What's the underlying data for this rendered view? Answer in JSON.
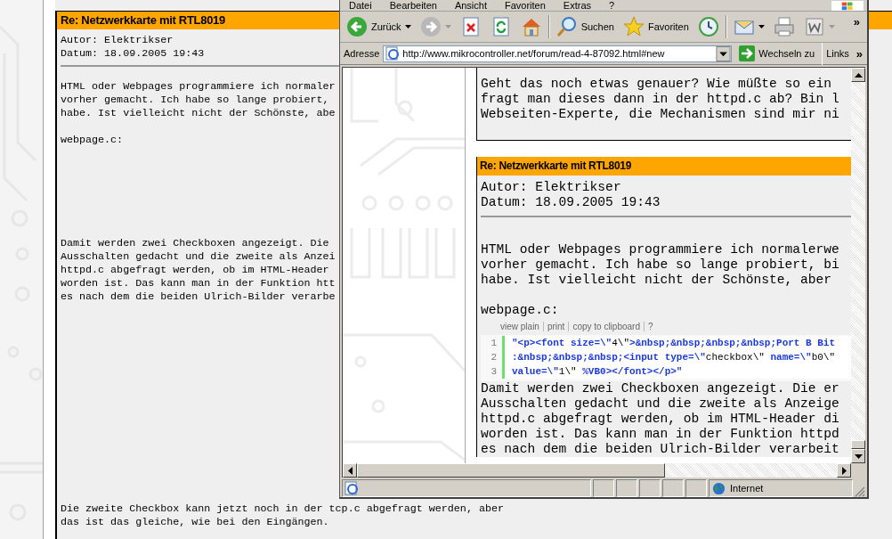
{
  "background_page": {
    "post": {
      "title": "Re: Netzwerkkarte mit RTL8019",
      "author": "Autor: Elektrikser",
      "date": "Datum: 18.09.2005 19:43",
      "intro": [
        "HTML oder Webpages programmiere ich normaler",
        "vorher gemacht. Ich habe so lange probiert,",
        "habe. Ist vielleicht nicht der Schönste, abe"
      ],
      "code_file": "webpage.c:",
      "after_code": [
        "Damit werden zwei Checkboxen angezeigt. Die",
        "Ausschalten gedacht und die zweite als Anzei",
        "httpd.c abgefragt werden, ob im HTML-Header",
        "worden ist. Das kann man in der Funktion htt",
        "es nach dem die beiden Ulrich-Bilder verarbe"
      ],
      "closing": [
        "Die zweite Checkbox kann jetzt noch in der tcp.c abgefragt werden, aber",
        "das ist das gleiche, wie bei den Eingängen."
      ]
    }
  },
  "browser": {
    "menu": [
      "Datei",
      "Bearbeiten",
      "Ansicht",
      "Favoriten",
      "Extras",
      "?"
    ],
    "toolbar": [
      {
        "kind": "back",
        "label": "Zurück"
      },
      {
        "kind": "forward"
      },
      {
        "kind": "stop"
      },
      {
        "kind": "refresh"
      },
      {
        "kind": "home"
      },
      {
        "kind": "separator"
      },
      {
        "kind": "search",
        "label": "Suchen"
      },
      {
        "kind": "favorites",
        "label": "Favoriten"
      },
      {
        "kind": "history"
      },
      {
        "kind": "separator"
      },
      {
        "kind": "mail"
      },
      {
        "kind": "print"
      },
      {
        "kind": "edit"
      }
    ],
    "toolbar_more": "»",
    "address": {
      "label": "Adresse",
      "url": "http://www.mikrocontroller.net/forum/read-4-87092.html#new",
      "go": "Wechseln zu",
      "links": "Links",
      "more": "»"
    },
    "page": {
      "previous_post": [
        "Geht das noch etwas genauer? Wie müßte so ein",
        "fragt man dieses dann in der httpd.c ab? Bin l",
        "Webseiten-Experte, die Mechanismen sind mir ni"
      ],
      "post": {
        "title": "Re: Netzwerkkarte mit RTL8019",
        "author": "Autor: Elektrikser",
        "date": "Datum: 18.09.2005 19:43",
        "intro": [
          "HTML oder Webpages programmiere ich normalerwe",
          "vorher gemacht. Ich habe so lange probiert, bi",
          "habe. Ist vielleicht nicht der Schönste, aber"
        ],
        "code_file": "webpage.c:",
        "code_tools": [
          "view plain",
          "print",
          "copy to clipboard",
          "?"
        ],
        "code": [
          {
            "number": "1",
            "segments": [
              {
                "kind": "string",
                "text": "\"<p><font size=\\\""
              },
              {
                "kind": "plain",
                "text": "4\\\""
              },
              {
                "kind": "string",
                "text": ">&nbsp;&nbsp;&nbsp;&nbsp;Port B Bit"
              }
            ]
          },
          {
            "number": "2",
            "segments": [
              {
                "kind": "string",
                "text": ":&nbsp;&nbsp;&nbsp;<input type=\\\""
              },
              {
                "kind": "plain",
                "text": "checkbox\\\""
              },
              {
                "kind": "string",
                "text": " name=\\\""
              },
              {
                "kind": "plain",
                "text": "b0\\\""
              }
            ]
          },
          {
            "number": "3",
            "segments": [
              {
                "kind": "string",
                "text": "value=\\\""
              },
              {
                "kind": "plain",
                "text": "1\\\""
              },
              {
                "kind": "string",
                "text": " %VB0></font></p>\""
              }
            ]
          }
        ],
        "after_code": [
          "Damit werden zwei Checkboxen angezeigt. Die er",
          "Ausschalten gedacht und die zweite als Anzeige",
          "httpd.c abgefragt werden, ob im HTML-Header di",
          "worden ist. Das kann man in der Funktion httpd",
          "es nach dem die beiden Ulrich-Bilder verarbeit"
        ]
      }
    },
    "status_bar": {
      "zone": "Internet"
    }
  }
}
